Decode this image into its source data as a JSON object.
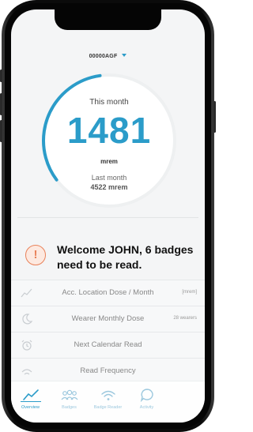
{
  "device": {
    "id_label": "00000AGF",
    "caret_icon": "caret-down-icon"
  },
  "dose": {
    "this_month_label": "This month",
    "value": "1481",
    "unit": "mrem",
    "last_month_label": "Last month",
    "last_month_value": "4522 mrem",
    "progress_fraction": 0.33,
    "accent_color": "#2b9cc9"
  },
  "welcome": {
    "icon": "alert-icon",
    "icon_glyph": "!",
    "message": "Welcome JOHN, 6 badges need to be read."
  },
  "rows": [
    {
      "icon": "line-chart-icon",
      "label": "Acc. Location Dose / Month",
      "tag": "[mrem]"
    },
    {
      "icon": "moon-icon",
      "label": "Wearer Monthly Dose",
      "tag": "28 wearers"
    },
    {
      "icon": "alarm-clock-icon",
      "label": "Next Calendar Read",
      "tag": ""
    },
    {
      "icon": "wifi-icon",
      "label": "Read Frequency",
      "tag": ""
    }
  ],
  "tabs": [
    {
      "icon": "line-chart-icon",
      "label": "Overview",
      "active": true
    },
    {
      "icon": "people-icon",
      "label": "Badges",
      "active": false
    },
    {
      "icon": "wifi-icon",
      "label": "Badge Reader",
      "active": false
    },
    {
      "icon": "speech-bubble-icon",
      "label": "Activity",
      "active": false
    }
  ]
}
